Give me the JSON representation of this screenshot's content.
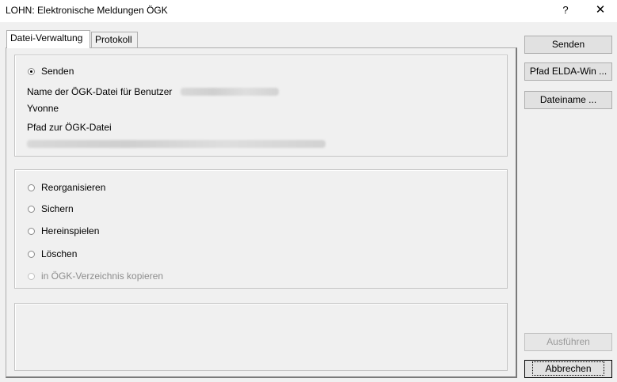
{
  "window": {
    "title": "LOHN: Elektronische Meldungen ÖGK",
    "help_glyph": "?",
    "close_glyph": "✕"
  },
  "tabs": [
    {
      "label": "Datei-Verwaltung",
      "active": true
    },
    {
      "label": "Protokoll",
      "active": false
    }
  ],
  "send_group": {
    "radio_label": "Senden",
    "file_name_label": "Name der ÖGK-Datei für Benutzer",
    "user_name": "Yvonne",
    "path_label": "Pfad zur ÖGK-Datei"
  },
  "options_group": {
    "items": [
      {
        "label": "Reorganisieren",
        "enabled": true
      },
      {
        "label": "Sichern",
        "enabled": true
      },
      {
        "label": "Hereinspielen",
        "enabled": true
      },
      {
        "label": "Löschen",
        "enabled": true
      },
      {
        "label": "in ÖGK-Verzeichnis kopieren",
        "enabled": false
      }
    ]
  },
  "buttons": {
    "send": "Senden",
    "elda_path": "Pfad ELDA-Win ...",
    "filename": "Dateiname ...",
    "execute": "Ausführen",
    "cancel": "Abbrechen"
  }
}
